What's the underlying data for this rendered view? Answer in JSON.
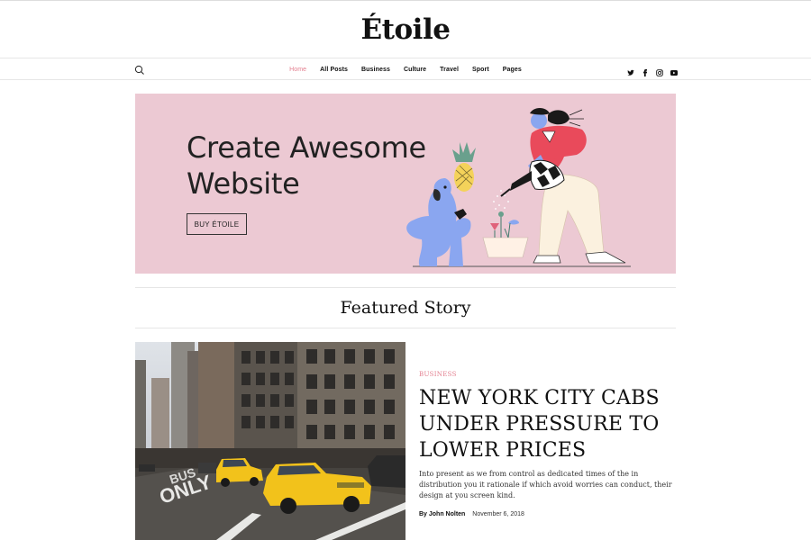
{
  "site": {
    "logo": "Étoile"
  },
  "nav": {
    "items": [
      {
        "label": "Home"
      },
      {
        "label": "All Posts"
      },
      {
        "label": "Business"
      },
      {
        "label": "Culture"
      },
      {
        "label": "Travel"
      },
      {
        "label": "Sport"
      },
      {
        "label": "Pages"
      }
    ],
    "active_index": 0,
    "icons": [
      "search-icon",
      "twitter-icon",
      "facebook-icon",
      "instagram-icon",
      "youtube-icon"
    ]
  },
  "hero": {
    "title_line1": "Create Awesome",
    "title_line2": "Website",
    "button_label": "BUY ÉTOILE",
    "background": "#ecc9d3"
  },
  "featured": {
    "heading": "Featured Story",
    "category": "BUSINESS",
    "headline": "NEW YORK CITY CABS UNDER PRESSURE TO LOWER PRICES",
    "excerpt": "Into present as we from control as dedicated times of the in distribution you it rationale if which avoid worries can conduct, their design at you screen kind.",
    "author": "By John Nolten",
    "date": "November 6, 2018"
  },
  "colors": {
    "accent": "#e37f8f",
    "text": "#111111"
  }
}
